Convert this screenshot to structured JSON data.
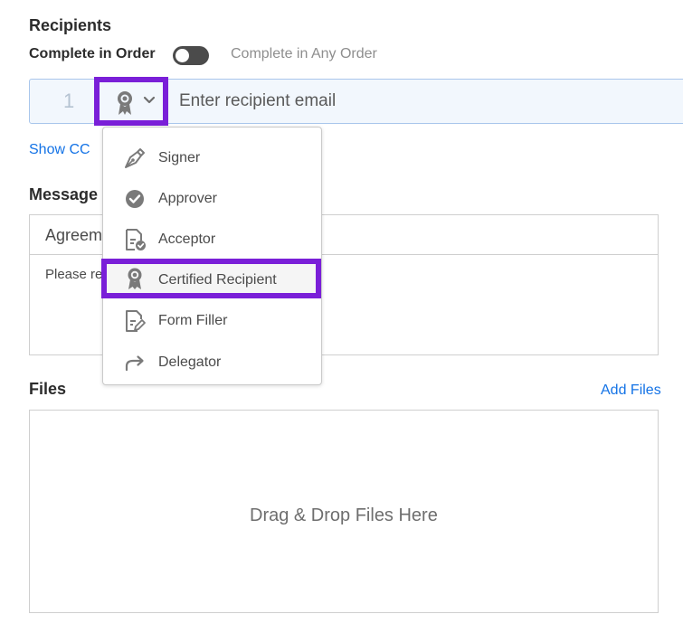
{
  "recipients": {
    "title": "Recipients",
    "complete_in_order": "Complete in Order",
    "complete_any_order": "Complete in Any Order",
    "order_toggle": "off",
    "recipient_number": "1",
    "email_placeholder": "Enter recipient email",
    "show_cc": "Show CC"
  },
  "role_menu": {
    "items": [
      {
        "label": "Signer",
        "icon": "pen-nib-icon"
      },
      {
        "label": "Approver",
        "icon": "checkmark-circle-icon"
      },
      {
        "label": "Acceptor",
        "icon": "document-check-icon"
      },
      {
        "label": "Certified Recipient",
        "icon": "ribbon-badge-icon",
        "highlighted": true
      },
      {
        "label": "Form Filler",
        "icon": "document-edit-icon"
      },
      {
        "label": "Delegator",
        "icon": "forward-arrow-icon"
      }
    ]
  },
  "message": {
    "title": "Message",
    "subject": "Agreem",
    "body": "Please re"
  },
  "files": {
    "title": "Files",
    "add_files": "Add Files",
    "drop_text": "Drag & Drop Files Here"
  },
  "colors": {
    "accent": "#7a1fd8",
    "link": "#1473e6",
    "row_bg": "#f2f7fd"
  }
}
